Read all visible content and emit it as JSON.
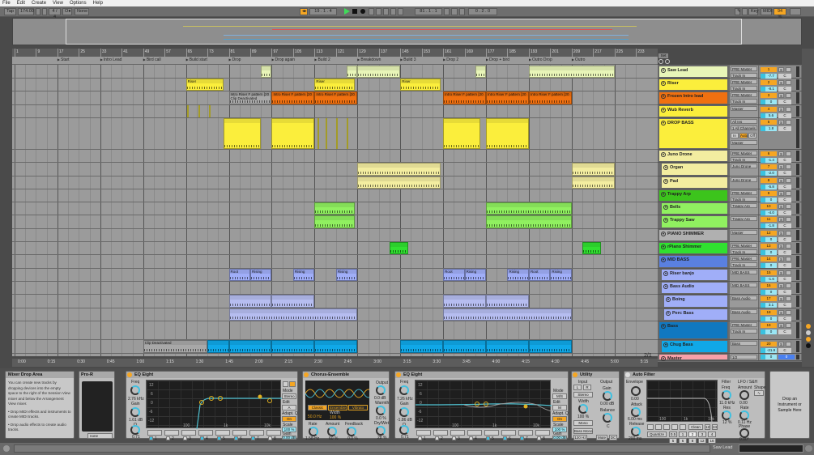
{
  "menu": [
    "File",
    "Edit",
    "Create",
    "View",
    "Options",
    "Help"
  ],
  "transport": {
    "tap": "Tap",
    "tempo": "174.00",
    "sig": "4 / 4",
    "metro": "O●",
    "quant": "None",
    "position": "19 . 1 . 4",
    "loop_start": "81 . 1 . 1",
    "loop_len": "0 . 2 . 0",
    "key": "Key",
    "midi": "MIDI",
    "cpu": "94 %"
  },
  "ruler_bars": [
    "1",
    "9",
    "17",
    "25",
    "33",
    "41",
    "49",
    "57",
    "65",
    "73",
    "81",
    "89",
    "97",
    "105",
    "113",
    "121",
    "129",
    "137",
    "145",
    "153",
    "161",
    "169",
    "177",
    "185",
    "193",
    "201",
    "209",
    "217",
    "225",
    "233"
  ],
  "locators": [
    {
      "name": "Start",
      "bar": 17
    },
    {
      "name": "Intro Lead",
      "bar": 33
    },
    {
      "name": "Bird call",
      "bar": 49
    },
    {
      "name": "Build start",
      "bar": 65
    },
    {
      "name": "Drop",
      "bar": 81
    },
    {
      "name": "Drop again",
      "bar": 97
    },
    {
      "name": "Build 2",
      "bar": 113
    },
    {
      "name": "Breakdown",
      "bar": 129
    },
    {
      "name": "Build 3",
      "bar": 145
    },
    {
      "name": "Drop 2",
      "bar": 161
    },
    {
      "name": "Drop + bird",
      "bar": 177
    },
    {
      "name": "Outro Drop",
      "bar": 193
    },
    {
      "name": "Outro",
      "bar": 209
    }
  ],
  "time_labels": [
    "0:00",
    "0:15",
    "0:30",
    "0:45",
    "1:00",
    "1:15",
    "1:30",
    "1:45",
    "2:00",
    "2:15",
    "2:30",
    "2:45",
    "3:00",
    "3:15",
    "3:30",
    "3:45",
    "4:00",
    "4:15",
    "4:30",
    "4:45",
    "5:00",
    "5:15"
  ],
  "set_label": "Set",
  "zoom_label": "2/1",
  "tracks": [
    {
      "name": "Saw Lead",
      "color": "#e8f5b8",
      "h": 16,
      "r1": "PRE Master",
      "r2": "Track In",
      "num": "1",
      "vol": "-7.7"
    },
    {
      "name": "Riser",
      "color": "#fbee3c",
      "h": 16,
      "r1": "PRE Master",
      "r2": "Track In",
      "num": "2",
      "vol": "-8.1"
    },
    {
      "name": "Frozen Intro lead",
      "color": "#f07010",
      "h": 17,
      "r1": "PRE Master",
      "r2": "Track In",
      "num": "3",
      "vol": "0"
    },
    {
      "name": "Wub Reverb",
      "color": "#fbee3c",
      "h": 16,
      "r1": "Master",
      "r2": "",
      "num": "4",
      "vol": "5.6"
    },
    {
      "name": "DROP BASS",
      "color": "#fbee3c",
      "h": 39,
      "r1": "All Ins",
      "r2": "1 All Channels",
      "mon": [
        "In",
        "Auto",
        "Off"
      ],
      "r3": "Master",
      "num": "5",
      "vol": "1.8"
    },
    {
      "name": "Juno Drone",
      "color": "#f3eda0",
      "h": 16,
      "r1": "PRE Master",
      "r2": "Track In",
      "num": "6",
      "vol": "-1.4"
    },
    {
      "name": "Organ",
      "color": "#f3eda0",
      "h": 17,
      "r1": "Juno Drone",
      "r2": "",
      "num": "7",
      "vol": "-2.0",
      "indent": 1
    },
    {
      "name": "Pad",
      "color": "#f3eda0",
      "h": 16,
      "r1": "Juno Drone",
      "r2": "",
      "num": "8",
      "vol": "-5.8",
      "indent": 1
    },
    {
      "name": "Trappy Arp",
      "color": "#3cc41c",
      "h": 16,
      "r1": "PRE Master",
      "r2": "Track In",
      "num": "9",
      "vol": "0"
    },
    {
      "name": "Bells",
      "color": "#90f060",
      "h": 16,
      "r1": "Trappy Arp",
      "r2": "",
      "num": "10",
      "vol": "-4.0",
      "indent": 1
    },
    {
      "name": "Trappy Saw",
      "color": "#90f060",
      "h": 17,
      "r1": "Trappy Arp",
      "r2": "",
      "num": "11",
      "vol": "-1.8",
      "indent": 1
    },
    {
      "name": "PIANO SHIMMER",
      "color": "#b0b0b0",
      "h": 16,
      "r1": "Master",
      "r2": "",
      "num": "12",
      "vol": "0"
    },
    {
      "name": "rPiano Shimmer",
      "color": "#30e030",
      "h": 16,
      "r1": "PRE Master",
      "r2": "Track In",
      "num": "13",
      "vol": "0"
    },
    {
      "name": "MID BASS",
      "color": "#5a80e0",
      "h": 17,
      "r1": "PRE Master",
      "r2": "Track In",
      "num": "14",
      "vol": "0"
    },
    {
      "name": "Riser banjo",
      "color": "#a0aef8",
      "h": 16,
      "r1": "MID BASS",
      "r2": "",
      "num": "15",
      "vol": "-1.6",
      "indent": 1
    },
    {
      "name": "Bass Audio",
      "color": "#a0aef8",
      "h": 16,
      "r1": "MID BASS",
      "r2": "",
      "num": "16",
      "vol": "0",
      "indent": 1
    },
    {
      "name": "Boing",
      "color": "#a0aef8",
      "h": 17,
      "r1": "Bass Audio",
      "r2": "",
      "num": "17",
      "vol": "3.1",
      "indent": 2
    },
    {
      "name": "Perc Bass",
      "color": "#a0aef8",
      "h": 16,
      "r1": "Bass Audio",
      "r2": "",
      "num": "18",
      "vol": "0",
      "indent": 2
    },
    {
      "name": "Bass",
      "color": "#1078c0",
      "h": 23,
      "r1": "PRE Master",
      "r2": "Track In",
      "num": "19",
      "vol": "0"
    },
    {
      "name": "Chug Bass",
      "color": "#10a8e8",
      "h": 17,
      "r1": "Bass",
      "r2": "",
      "num": "20",
      "vol": "-21.9",
      "indent": 1
    },
    {
      "name": "Master",
      "color": "#f8a0a8",
      "h": 9,
      "r1": "1/2",
      "r2": "",
      "num": "0",
      "vol": "0",
      "master": true
    }
  ],
  "send_label": "S",
  "pan_label": "C",
  "clips": [
    {
      "t": 0,
      "s": 93,
      "l": 4,
      "n": "",
      "c": "#e8f5b8"
    },
    {
      "t": 0,
      "s": 125,
      "l": 4,
      "n": "",
      "c": "#e8f5b8"
    },
    {
      "t": 0,
      "s": 129,
      "l": 16,
      "n": "",
      "c": "#e8f5b8"
    },
    {
      "t": 0,
      "s": 173,
      "l": 4,
      "n": "",
      "c": "#e8f5b8"
    },
    {
      "t": 0,
      "s": 193,
      "l": 32,
      "n": "",
      "c": "#e8f5b8"
    },
    {
      "t": 1,
      "s": 65,
      "l": 14,
      "n": "Riser",
      "c": "#fbee3c"
    },
    {
      "t": 1,
      "s": 113,
      "l": 15,
      "n": "Riser",
      "c": "#fbee3c"
    },
    {
      "t": 1,
      "s": 145,
      "l": 15,
      "n": "Riser",
      "c": "#fbee3c"
    },
    {
      "t": 2,
      "s": 81,
      "l": 16,
      "n": "Intro Riser F pattern [20",
      "c": "#a8a8a8",
      "sub": "Clip Deactivated"
    },
    {
      "t": 2,
      "s": 97,
      "l": 16,
      "n": "Intro Riser F pattern [20",
      "c": "#f07010"
    },
    {
      "t": 2,
      "s": 113,
      "l": 16,
      "n": "Intro Riser F pattern [20",
      "c": "#f07010"
    },
    {
      "t": 2,
      "s": 161,
      "l": 16,
      "n": "Intro Riser F pattern [20",
      "c": "#f07010"
    },
    {
      "t": 2,
      "s": 177,
      "l": 16,
      "n": "Intro Riser F pattern [20",
      "c": "#f07010"
    },
    {
      "t": 2,
      "s": 193,
      "l": 16,
      "n": "Intro Riser F pattern [20",
      "c": "#f07010"
    },
    {
      "t": 3,
      "s": 65.5,
      "l": 0.6,
      "n": "",
      "c": "#fbee3c"
    },
    {
      "t": 3,
      "s": 69.5,
      "l": 0.6,
      "n": "",
      "c": "#fbee3c"
    },
    {
      "t": 3,
      "s": 73.5,
      "l": 0.6,
      "n": "",
      "c": "#fbee3c"
    },
    {
      "t": 4,
      "s": 79,
      "l": 14,
      "n": "",
      "c": "#fbee3c"
    },
    {
      "t": 4,
      "s": 97,
      "l": 16,
      "n": "",
      "c": "#fbee3c"
    },
    {
      "t": 4,
      "s": 114,
      "l": 0.6,
      "n": "",
      "c": "#fbee3c"
    },
    {
      "t": 4,
      "s": 117,
      "l": 0.6,
      "n": "",
      "c": "#fbee3c"
    },
    {
      "t": 4,
      "s": 121,
      "l": 0.6,
      "n": "",
      "c": "#fbee3c"
    },
    {
      "t": 4,
      "s": 125,
      "l": 0.6,
      "n": "",
      "c": "#fbee3c"
    },
    {
      "t": 4,
      "s": 161,
      "l": 14,
      "n": "",
      "c": "#fbee3c"
    },
    {
      "t": 4,
      "s": 177,
      "l": 16,
      "n": "",
      "c": "#fbee3c"
    },
    {
      "t": 6,
      "s": 129,
      "l": 31,
      "n": "",
      "c": "#f3eda0"
    },
    {
      "t": 6,
      "s": 209,
      "l": 16,
      "n": "",
      "c": "#f3eda0"
    },
    {
      "t": 7,
      "s": 129,
      "l": 31,
      "n": "",
      "c": "#f3eda0"
    },
    {
      "t": 7,
      "s": 209,
      "l": 16,
      "n": "",
      "c": "#f3eda0"
    },
    {
      "t": 9,
      "s": 113,
      "l": 15,
      "n": "",
      "c": "#90f060"
    },
    {
      "t": 9,
      "s": 177,
      "l": 32,
      "n": "",
      "c": "#90f060"
    },
    {
      "t": 10,
      "s": 113,
      "l": 15,
      "n": "",
      "c": "#90f060"
    },
    {
      "t": 10,
      "s": 177,
      "l": 32,
      "n": "",
      "c": "#90f060"
    },
    {
      "t": 12,
      "s": 141,
      "l": 7,
      "n": "",
      "c": "#30e030"
    },
    {
      "t": 12,
      "s": 213,
      "l": 7,
      "n": "",
      "c": "#30e030"
    },
    {
      "t": 14,
      "s": 81,
      "l": 8,
      "n": "Root",
      "c": "#a0aef8"
    },
    {
      "t": 14,
      "s": 89,
      "l": 8,
      "n": "Rising",
      "c": "#a0aef8"
    },
    {
      "t": 14,
      "s": 105,
      "l": 8,
      "n": "Rising",
      "c": "#a0aef8"
    },
    {
      "t": 14,
      "s": 121,
      "l": 8,
      "n": "Rising",
      "c": "#a0aef8"
    },
    {
      "t": 14,
      "s": 161,
      "l": 8,
      "n": "Root",
      "c": "#a0aef8"
    },
    {
      "t": 14,
      "s": 169,
      "l": 8,
      "n": "Rising",
      "c": "#a0aef8"
    },
    {
      "t": 14,
      "s": 185,
      "l": 8,
      "n": "Rising",
      "c": "#a0aef8"
    },
    {
      "t": 14,
      "s": 193,
      "l": 8,
      "n": "Root",
      "c": "#a0aef8"
    },
    {
      "t": 14,
      "s": 201,
      "l": 8,
      "n": "Rising",
      "c": "#a0aef8"
    },
    {
      "t": 16,
      "s": 81,
      "l": 16,
      "n": "",
      "c": "#b6bdf0"
    },
    {
      "t": 16,
      "s": 97,
      "l": 16,
      "n": "",
      "c": "#b6bdf0"
    },
    {
      "t": 16,
      "s": 161,
      "l": 16,
      "n": "",
      "c": "#b6bdf0"
    },
    {
      "t": 16,
      "s": 177,
      "l": 16,
      "n": "",
      "c": "#b6bdf0"
    },
    {
      "t": 17,
      "s": 81,
      "l": 48,
      "n": "",
      "c": "#b6bdf0"
    },
    {
      "t": 17,
      "s": 161,
      "l": 48,
      "n": "",
      "c": "#b6bdf0"
    },
    {
      "t": 19,
      "s": 49,
      "l": 24,
      "n": "Clip Deactivated",
      "c": "#a8a8a8"
    },
    {
      "t": 19,
      "s": 73,
      "l": 8,
      "n": "",
      "c": "#10a8e8"
    },
    {
      "t": 19,
      "s": 81,
      "l": 16,
      "n": "",
      "c": "#10a8e8"
    },
    {
      "t": 19,
      "s": 97,
      "l": 16,
      "n": "",
      "c": "#10a8e8"
    },
    {
      "t": 19,
      "s": 113,
      "l": 16,
      "n": "",
      "c": "#10a8e8"
    },
    {
      "t": 19,
      "s": 145,
      "l": 16,
      "n": "",
      "c": "#10a8e8"
    },
    {
      "t": 19,
      "s": 161,
      "l": 16,
      "n": "",
      "c": "#10a8e8"
    },
    {
      "t": 19,
      "s": 177,
      "l": 16,
      "n": "",
      "c": "#10a8e8"
    },
    {
      "t": 19,
      "s": 193,
      "l": 16,
      "n": "",
      "c": "#10a8e8"
    }
  ],
  "devices": {
    "info": {
      "title": "Mixer Drop Area",
      "text": "You can create new tracks by dropping devices into the empty space to the right of the Session View mixer and below the Arrangement View mixer.",
      "b1": "Drop MIDI effects and instruments to create MIDI tracks.",
      "b2": "Drop audio effects to create audio tracks."
    },
    "pror": {
      "title": "Pro-R",
      "field": "none"
    },
    "eq1": {
      "title": "EQ Eight",
      "freq_l": "Freq",
      "freq": "2.76 kHz",
      "gain_l": "Gain",
      "gain": "1.61 dB",
      "q_l": "Q",
      "q": "0.71",
      "db": [
        "12",
        "6",
        "0",
        "-6",
        "-12"
      ],
      "hz": [
        "100",
        "1k",
        "10k"
      ],
      "bands": [
        "1",
        "2",
        "3",
        "4",
        "5",
        "6",
        "7",
        "8"
      ],
      "mode_l": "Mode",
      "mode": "Stereo",
      "edit_l": "Edit",
      "edit": "A",
      "adapt_l": "Adapt. Q",
      "adapt": "On",
      "scale_l": "Scale",
      "scale": "100 %",
      "ogain_l": "Gain",
      "ogain": "0.00 dB"
    },
    "chorus": {
      "title": "Chorus-Ensemble",
      "modes": [
        "Classic",
        "Ensemble",
        "Vibrato"
      ],
      "hz": "50.0 Hz",
      "width_l": "Width",
      "width": "100 %",
      "rate_l": "Rate",
      "rate": "1.58 Hz",
      "amount_l": "Amount",
      "amount": "60 %",
      "fb_l": "Feedback",
      "fb": "0.0 %",
      "out_l": "Output",
      "out": "0.0 dB",
      "warm_l": "Warmth",
      "warm": "0.0 %",
      "dw_l": "Dry/Wet",
      "dw": "28 %"
    },
    "eq2": {
      "title": "EQ Eight",
      "freq": "7.26 kHz",
      "gain": "-1.86 dB",
      "q": "0.71",
      "mode": "M/S",
      "edit": "M",
      "adapt": "On",
      "scale": "100 %",
      "ogain": "0.00 dB"
    },
    "utility": {
      "title": "Utility",
      "input_l": "Input",
      "l": "L",
      "r": "R",
      "stereo": "Stereo",
      "width_l": "Width",
      "width": "100 %",
      "mono": "Mono",
      "bassmono": "Bass Mono",
      "hz": "120 Hz",
      "output_l": "Output",
      "gain_l": "Gain",
      "gain": "0.00 dB",
      "bal_l": "Balance",
      "bal": "C",
      "mute": "Mute",
      "dc": "DC"
    },
    "autofilter": {
      "title": "Auto Filter",
      "env_l": "Envelope",
      "env": "0.00",
      "att_l": "Attack",
      "att": "6.00 ms",
      "rel_l": "Release",
      "rel": "200 ms",
      "hz": [
        "100",
        "1k",
        "10k"
      ],
      "clean": "Clean",
      "s12": "12",
      "s24": "24",
      "quant": "Quantize",
      "qvals": [
        "0.5",
        "1",
        "2",
        "3",
        "4",
        "5",
        "6",
        "8",
        "12",
        "16"
      ],
      "filter_l": "Filter",
      "freq_l": "Freq",
      "freq": "11.0 kHz",
      "res_l": "Res",
      "res": "12 %",
      "lfo_l": "LFO / S&H",
      "amt_l": "Amount",
      "amt": "0.00",
      "shape_l": "Shape",
      "rate_l": "Rate",
      "rate": "0.11 Hz",
      "phase_l": "Phase",
      "phase": "0.00°"
    },
    "drop": "Drop an Instrument or Sample Here"
  },
  "status": {
    "track": "Saw Lead"
  }
}
